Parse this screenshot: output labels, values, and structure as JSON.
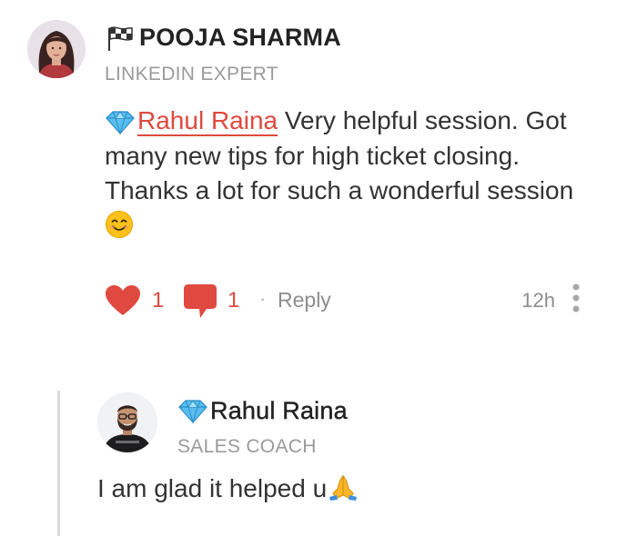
{
  "comment": {
    "author": {
      "name": "POOJA SHARMA",
      "role": "LINKEDIN EXPERT",
      "badge_icon": "checkered-flag-icon"
    },
    "mention": {
      "name": "Rahul Raina",
      "badge_icon": "diamond-icon"
    },
    "body": "Very helpful session. Got many new tips for high ticket closing. Thanks a lot for such a wonderful session",
    "body_emoji": "smiling-face-icon",
    "likes": "1",
    "replies": "1",
    "separator": "·",
    "reply_label": "Reply",
    "time": "12h"
  },
  "reply": {
    "author": {
      "name": "Rahul Raina",
      "role": "SALES COACH",
      "badge_icon": "diamond-icon"
    },
    "body": "I am glad it helped u",
    "body_emoji": "folded-hands-icon"
  },
  "colors": {
    "accent": "#e0493f",
    "muted": "#8d8d8d",
    "text": "#333333",
    "diamond": "#4fb3e8",
    "thread_line": "#d9d9d9"
  }
}
